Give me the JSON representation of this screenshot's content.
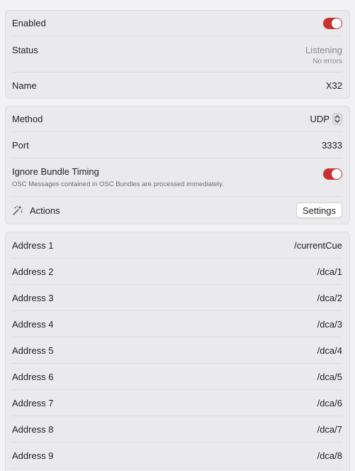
{
  "general": {
    "enabled_label": "Enabled",
    "enabled_on": true,
    "status_label": "Status",
    "status_value": "Listening",
    "status_detail": "No errors",
    "name_label": "Name",
    "name_value": "X32"
  },
  "connection": {
    "method_label": "Method",
    "method_value": "UDP",
    "port_label": "Port",
    "port_value": "3333",
    "ignore_timing_label": "Ignore Bundle Timing",
    "ignore_timing_description": "OSC Messages contained in OSC Bundles are processed immediately.",
    "ignore_timing_on": true,
    "actions_label": "Actions",
    "actions_icon": "sparkles-icon",
    "settings_button": "Settings"
  },
  "addresses": [
    {
      "label": "Address 1",
      "value": "/currentCue"
    },
    {
      "label": "Address 2",
      "value": "/dca/1"
    },
    {
      "label": "Address 3",
      "value": "/dca/2"
    },
    {
      "label": "Address 4",
      "value": "/dca/3"
    },
    {
      "label": "Address 5",
      "value": "/dca/4"
    },
    {
      "label": "Address 6",
      "value": "/dca/5"
    },
    {
      "label": "Address 7",
      "value": "/dca/6"
    },
    {
      "label": "Address 8",
      "value": "/dca/7"
    },
    {
      "label": "Address 9",
      "value": "/dca/8"
    }
  ],
  "colors": {
    "toggle_on": "#c7312f",
    "background": "#f2f1f3",
    "group_background": "#eae9ec"
  }
}
